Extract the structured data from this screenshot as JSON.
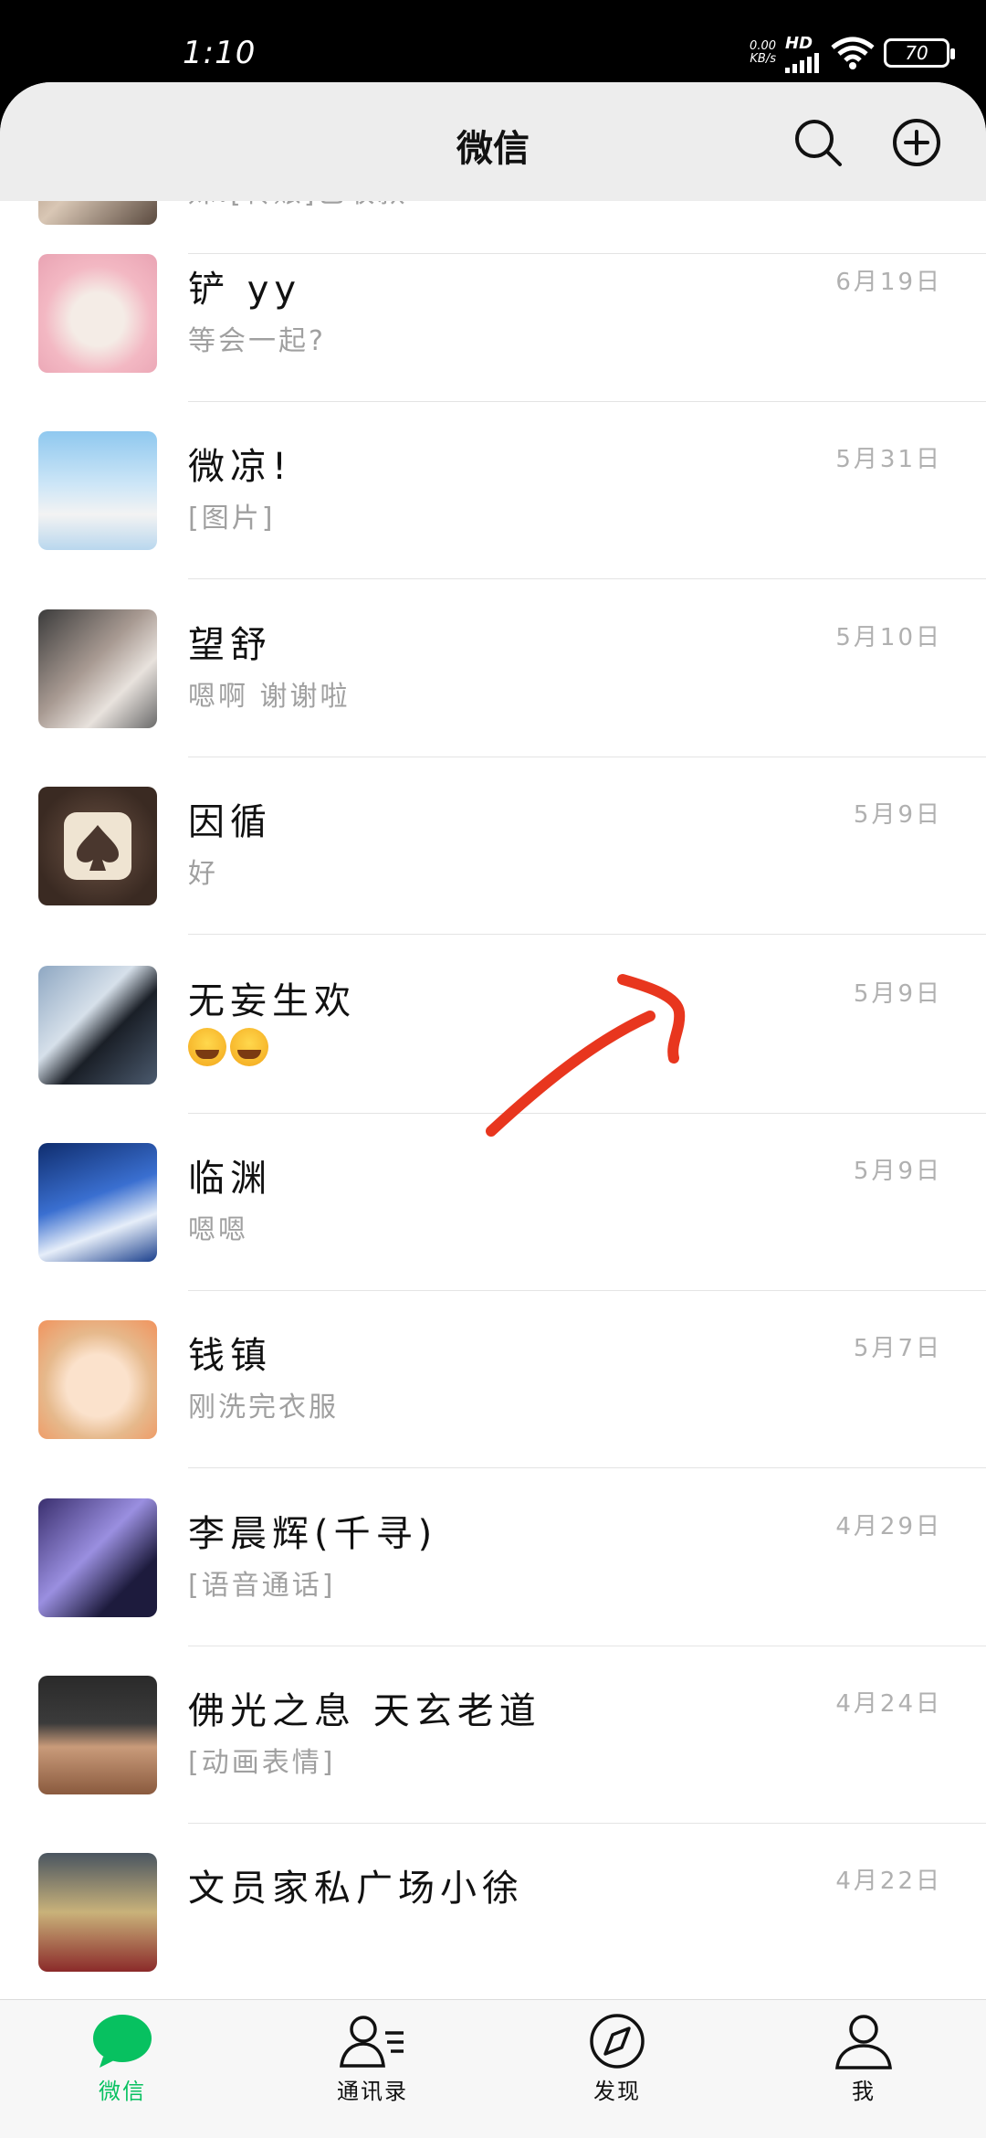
{
  "status_bar": {
    "time": "1:10",
    "net_speed_value": "0.00",
    "net_speed_unit": "KB/s",
    "hd": "HD",
    "battery": "70"
  },
  "header": {
    "title": "微信"
  },
  "chats": [
    {
      "name": "",
      "message": "妹:[转账]已收款",
      "date": ""
    },
    {
      "name": "铲 yy",
      "message": "等会一起?",
      "date": "6月19日"
    },
    {
      "name": "微凉!",
      "message": "[图片]",
      "date": "5月31日"
    },
    {
      "name": "望舒",
      "message": "嗯啊 谢谢啦",
      "date": "5月10日"
    },
    {
      "name": "因循",
      "message": "好",
      "date": "5月9日"
    },
    {
      "name": "无妄生欢",
      "message": "",
      "date": "5月9日"
    },
    {
      "name": "临渊",
      "message": "嗯嗯",
      "date": "5月9日"
    },
    {
      "name": "钱镇",
      "message": "刚洗完衣服",
      "date": "5月7日"
    },
    {
      "name": "李晨辉(千寻)",
      "message": "[语音通话]",
      "date": "4月29日"
    },
    {
      "name": "佛光之息 天玄老道",
      "message": "[动画表情]",
      "date": "4月24日"
    },
    {
      "name": "文员家私广场小徐",
      "message": "",
      "date": "4月22日"
    }
  ],
  "tabs": [
    {
      "label": "微信",
      "icon": "chat-bubble-icon",
      "active": true
    },
    {
      "label": "通讯录",
      "icon": "contacts-icon",
      "active": false
    },
    {
      "label": "发现",
      "icon": "compass-icon",
      "active": false
    },
    {
      "label": "我",
      "icon": "person-icon",
      "active": false
    }
  ],
  "colors": {
    "accent_green": "#07c160",
    "annotation_red": "#e8361e"
  }
}
